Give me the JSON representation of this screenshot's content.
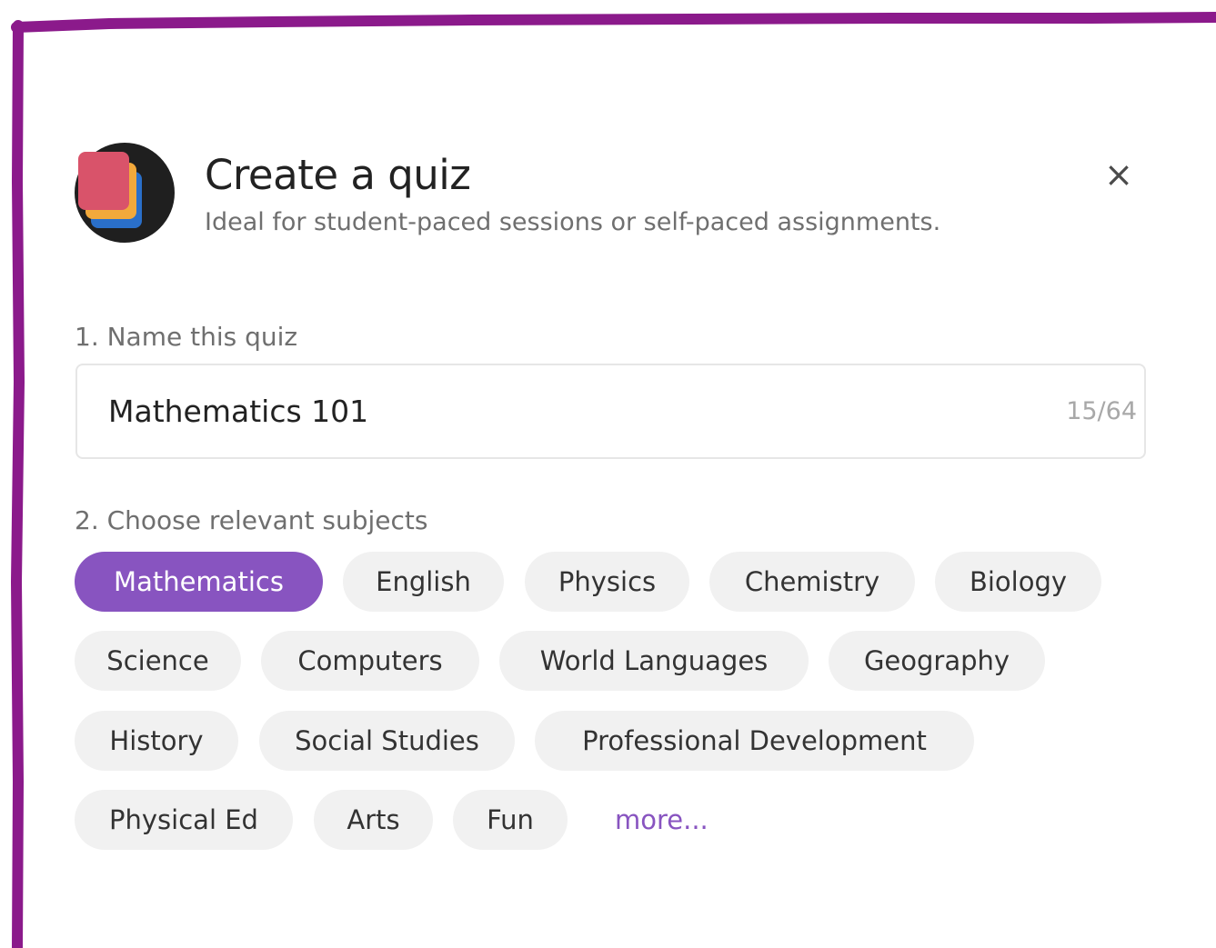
{
  "dialog": {
    "title": "Create a quiz",
    "subtitle": "Ideal for student-paced sessions or self-paced assignments.",
    "close_icon": "×"
  },
  "name_section": {
    "label": "1. Name this quiz",
    "value": "Mathematics 101",
    "counter": "15/64"
  },
  "subjects_section": {
    "label": "2. Choose relevant subjects",
    "chips": [
      {
        "label": "Mathematics",
        "selected": true
      },
      {
        "label": "English",
        "selected": false
      },
      {
        "label": "Physics",
        "selected": false
      },
      {
        "label": "Chemistry",
        "selected": false
      },
      {
        "label": "Biology",
        "selected": false
      },
      {
        "label": "Science",
        "selected": false
      },
      {
        "label": "Computers",
        "selected": false
      },
      {
        "label": "World Languages",
        "selected": false
      },
      {
        "label": "Geography",
        "selected": false
      },
      {
        "label": "History",
        "selected": false
      },
      {
        "label": "Social Studies",
        "selected": false
      },
      {
        "label": "Professional Development",
        "selected": false
      },
      {
        "label": "Physical Ed",
        "selected": false
      },
      {
        "label": "Arts",
        "selected": false
      },
      {
        "label": "Fun",
        "selected": false
      }
    ],
    "more_link": "more..."
  },
  "colors": {
    "accent": "#8854c0",
    "border": "#8b1a8b",
    "chip_bg": "#f1f1f1"
  },
  "icons": {
    "logo": "quiz-stack-logo-icon",
    "close": "close-icon"
  }
}
